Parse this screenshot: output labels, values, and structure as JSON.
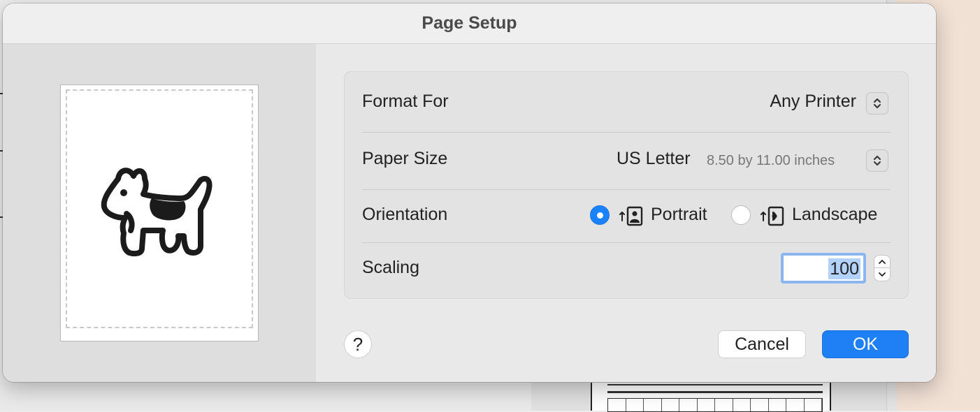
{
  "dialog": {
    "title": "Page Setup",
    "format_for": {
      "label": "Format For",
      "value": "Any Printer"
    },
    "paper_size": {
      "label": "Paper Size",
      "value": "US Letter",
      "detail": "8.50 by 11.00 inches"
    },
    "orientation": {
      "label": "Orientation",
      "options": [
        {
          "label": "Portrait",
          "selected": true
        },
        {
          "label": "Landscape",
          "selected": false
        }
      ]
    },
    "scaling": {
      "label": "Scaling",
      "value": "100"
    },
    "buttons": {
      "help": "?",
      "cancel": "Cancel",
      "ok": "OK"
    }
  },
  "colors": {
    "accent": "#1f7ff5",
    "selection": "#b3d2fb",
    "focus_ring": "#8cb4ee"
  }
}
